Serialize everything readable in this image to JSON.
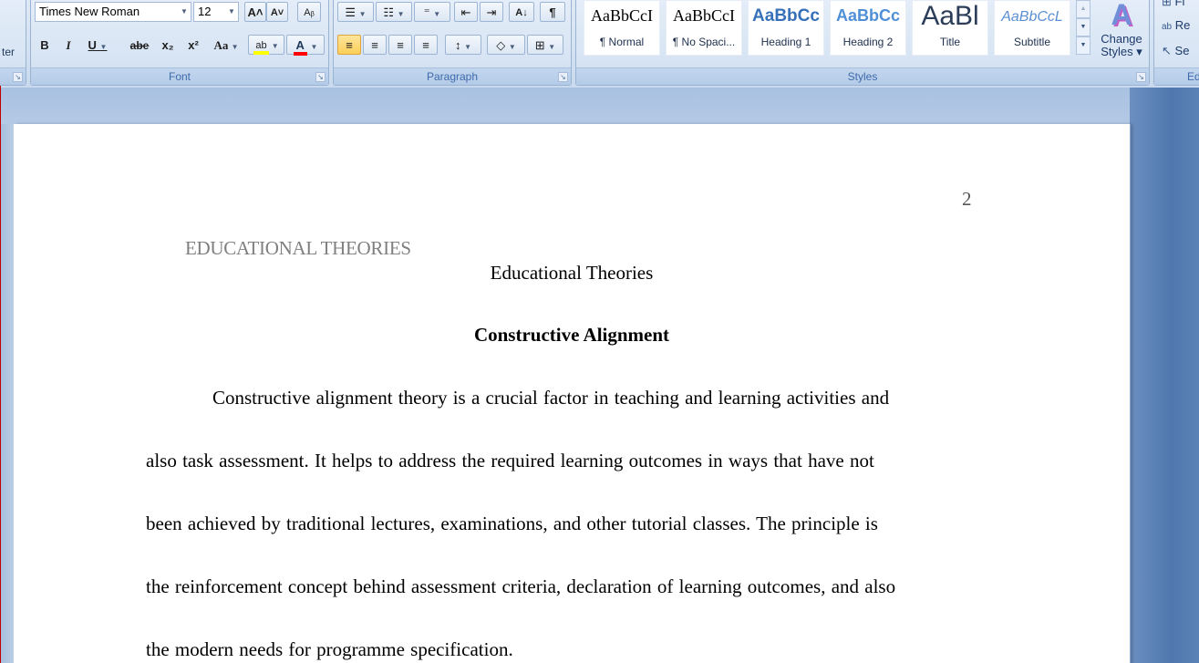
{
  "ribbon": {
    "clipboard": {
      "partial_label": "ter",
      "launcher": "↘"
    },
    "font": {
      "label": "Font",
      "font_name": "Times New Roman",
      "font_size": "12",
      "grow_icon": "A˄",
      "shrink_icon": "A˅",
      "clear_format_icon": "Aᵦ",
      "bold": "B",
      "italic": "I",
      "underline": "U",
      "strikethrough": "abe",
      "subscript": "x₂",
      "superscript": "x²",
      "change_case": "Aa",
      "highlight": "ab",
      "font_color": "A",
      "highlight_color": "#ffff00",
      "font_color_value": "#ff0000"
    },
    "paragraph": {
      "label": "Paragraph",
      "bullets": "☰",
      "numbering": "☷",
      "multilevel": "⁼",
      "decrease_indent": "⇤",
      "increase_indent": "⇥",
      "sort": "A↓",
      "show_marks": "¶",
      "align_left": "≡",
      "center": "≡",
      "align_right": "≡",
      "justify": "≡",
      "line_spacing": "↕",
      "shading": "◇",
      "borders": "⊞"
    },
    "styles": {
      "label": "Styles",
      "tiles": [
        {
          "sample": "AaBbCcI",
          "name": "¶ Normal"
        },
        {
          "sample": "AaBbCcI",
          "name": "¶ No Spaci..."
        },
        {
          "sample": "AaBbCc",
          "name": "Heading 1"
        },
        {
          "sample": "AaBbCc",
          "name": "Heading 2"
        },
        {
          "sample": "AaBl",
          "name": "Title"
        },
        {
          "sample": "AaBbCcL",
          "name": "Subtitle"
        }
      ],
      "change_styles_line1": "Change",
      "change_styles_line2": "Styles ▾",
      "change_styles_icon": "A"
    },
    "editing": {
      "label": "Edit",
      "find": "Fi",
      "replace": "Re",
      "select": "Se"
    }
  },
  "document": {
    "page_number": "2",
    "running_head": "EDUCATIONAL THEORIES",
    "title": "Educational Theories",
    "heading": "Constructive Alignment",
    "lines": [
      "Constructive alignment theory is a crucial  factor  in teaching and learning  activities  and",
      "also task assessment.  It helps to address the required  learning  outcomes  in ways  that have not",
      "been achieved  by traditional lectures,  examinations,  and other tutorial  classes.  The principle  is",
      "the reinforcement  concept behind assessment  criteria,  declaration  of learning  outcomes, and also",
      "the modern needs for programme specification."
    ]
  }
}
